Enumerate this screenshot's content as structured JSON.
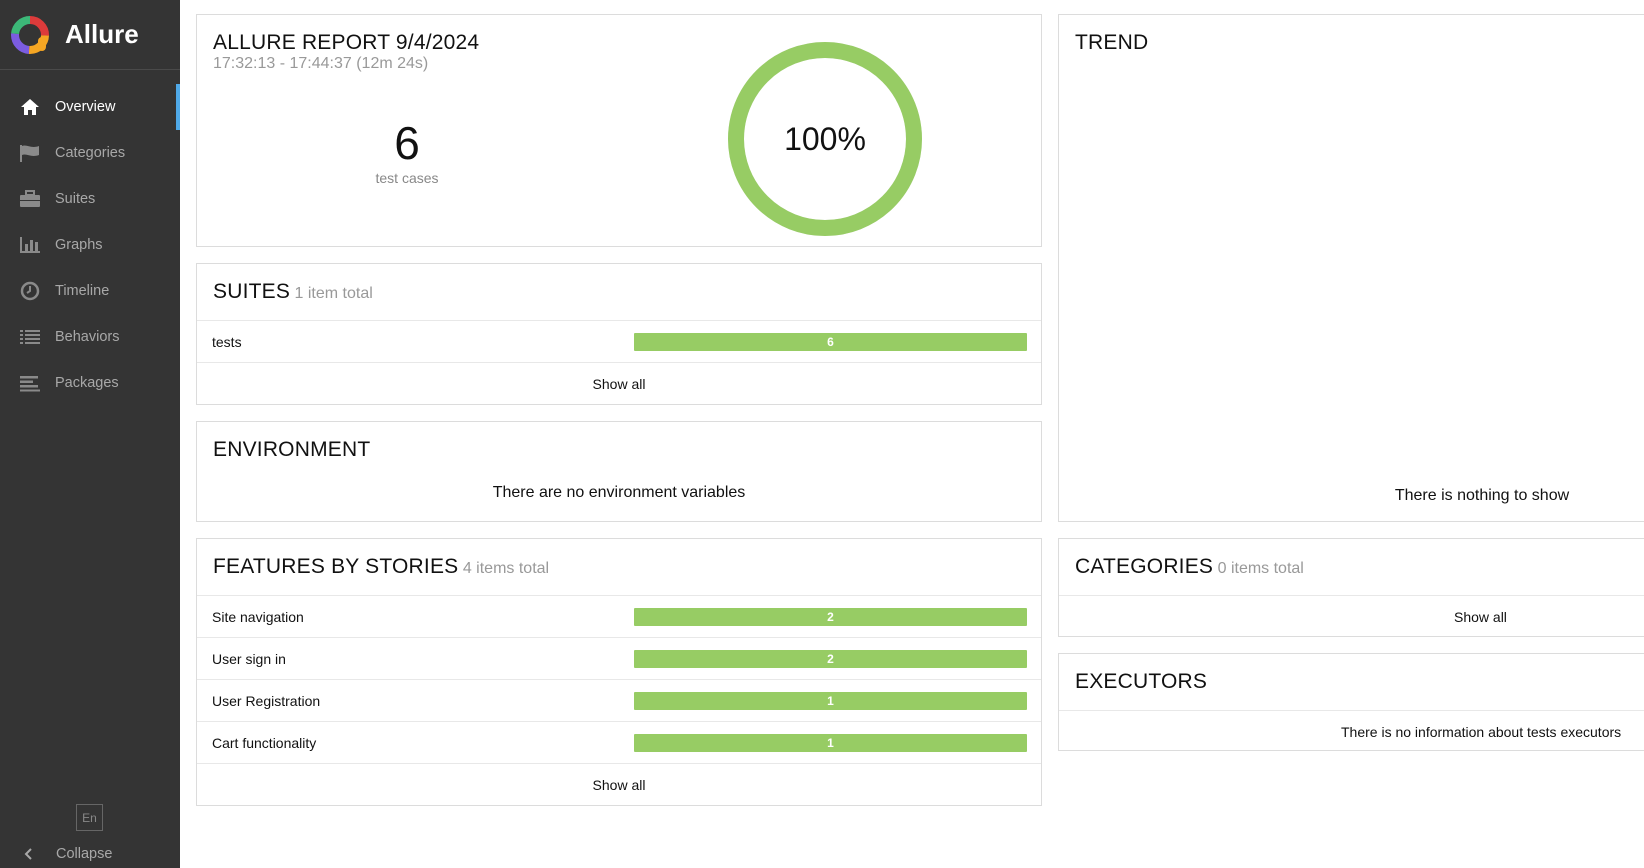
{
  "app": {
    "name": "Allure"
  },
  "sidebar": {
    "items": [
      {
        "label": "Overview",
        "icon": "home-icon"
      },
      {
        "label": "Categories",
        "icon": "flag-icon"
      },
      {
        "label": "Suites",
        "icon": "briefcase-icon"
      },
      {
        "label": "Graphs",
        "icon": "bar-chart-icon"
      },
      {
        "label": "Timeline",
        "icon": "clock-icon"
      },
      {
        "label": "Behaviors",
        "icon": "list-icon"
      },
      {
        "label": "Packages",
        "icon": "align-left-icon"
      }
    ],
    "language": "En",
    "collapse_label": "Collapse"
  },
  "summary": {
    "title": "ALLURE REPORT 9/4/2024",
    "time": "17:32:13 - 17:44:37 (12m 24s)",
    "test_count": "6",
    "test_label": "test cases",
    "percent": "100%",
    "pass_fraction": 1.0,
    "pass_color": "#97cc64"
  },
  "suites": {
    "title": "SUITES",
    "subtitle": "1 item total",
    "rows": [
      {
        "name": "tests",
        "count": "6"
      }
    ],
    "show_all": "Show all"
  },
  "environment": {
    "title": "ENVIRONMENT",
    "message": "There are no environment variables"
  },
  "features": {
    "title": "FEATURES BY STORIES",
    "subtitle": "4 items total",
    "rows": [
      {
        "name": "Site navigation",
        "count": "2"
      },
      {
        "name": "User sign in",
        "count": "2"
      },
      {
        "name": "User Registration",
        "count": "1"
      },
      {
        "name": "Cart functionality",
        "count": "1"
      }
    ],
    "show_all": "Show all"
  },
  "trend": {
    "title": "TREND",
    "message": "There is nothing to show"
  },
  "categories": {
    "title": "CATEGORIES",
    "subtitle": "0 items total",
    "show_all": "Show all"
  },
  "executors": {
    "title": "EXECUTORS",
    "message": "There is no information about tests executors"
  }
}
